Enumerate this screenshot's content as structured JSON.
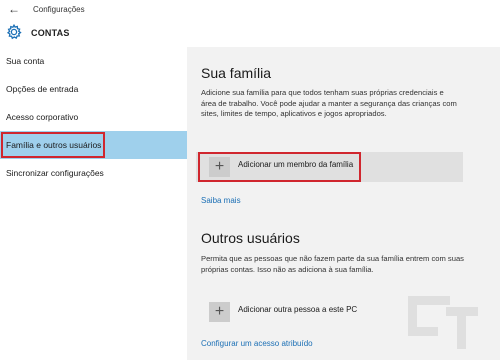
{
  "titlebar": {
    "back_icon": "back-arrow-icon",
    "title": "Configurações"
  },
  "header": {
    "icon": "gear-icon",
    "title": "CONTAS",
    "accent": "#1b6fb5"
  },
  "sidebar": {
    "items": [
      {
        "label": "Sua conta",
        "active": false
      },
      {
        "label": "Opções de entrada",
        "active": false
      },
      {
        "label": "Acesso corporativo",
        "active": false
      },
      {
        "label": "Família e outros usuários",
        "active": true
      },
      {
        "label": "Sincronizar configurações",
        "active": false
      }
    ],
    "active_color": "#9fd0ec",
    "highlight_color": "#d0262e"
  },
  "family": {
    "heading": "Sua família",
    "description": "Adicione sua família para que todos tenham suas próprias credenciais e área de trabalho. Você pode ajudar a manter a segurança das crianças com sites, limites de tempo, aplicativos e jogos apropriados.",
    "add_member_label": "Adicionar um membro da família",
    "learn_more": "Saiba mais"
  },
  "others": {
    "heading": "Outros usuários",
    "description": "Permita que as pessoas que não fazem parte da sua família entrem com suas próprias contas. Isso não as adiciona à sua família.",
    "add_other_label": "Adicionar outra pessoa a este PC",
    "assigned_access": "Configurar um acesso atribuído"
  },
  "plus_glyph": "+",
  "link_color": "#1b6fb5"
}
